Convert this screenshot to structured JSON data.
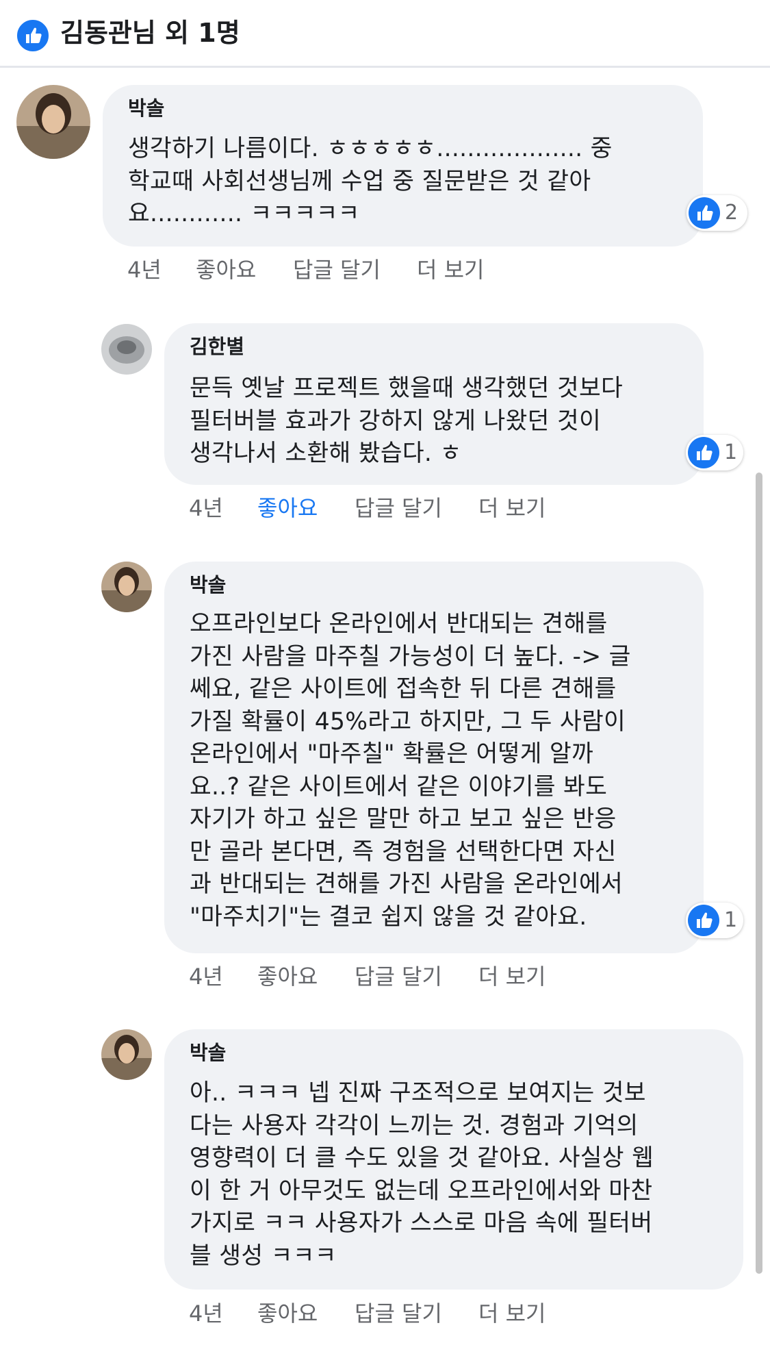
{
  "header": {
    "title": "김동관님 외 1명"
  },
  "comments": [
    {
      "author": "박솔",
      "lines": [
        "생각하기 나름이다. ㅎㅎㅎㅎㅎ................... 중",
        "학교때 사회선생님께 수업 중 질문받은 것 같아",
        "요............ ㅋㅋㅋㅋㅋ"
      ],
      "reactions": "2",
      "time": "4년",
      "like": "좋아요",
      "reply": "답글 달기",
      "more": "더 보기",
      "liked": false
    },
    {
      "author": "김한별",
      "lines": [
        "문득 옛날 프로젝트 했을때 생각했던 것보다",
        "필터버블 효과가 강하지 않게 나왔던 것이",
        "생각나서 소환해 봤습다. ㅎ"
      ],
      "reactions": "1",
      "time": "4년",
      "like": "좋아요",
      "reply": "답글 달기",
      "more": "더 보기",
      "liked": true
    },
    {
      "author": "박솔",
      "lines": [
        "오프라인보다 온라인에서 반대되는 견해를",
        "가진 사람을 마주칠 가능성이 더 높다. -> 글",
        "쎄요, 같은 사이트에 접속한 뒤 다른 견해를",
        "가질 확률이 45%라고 하지만, 그 두 사람이",
        "온라인에서 \"마주칠\" 확률은 어떻게 알까",
        "요..? 같은 사이트에서 같은 이야기를 봐도",
        "자기가 하고 싶은 말만 하고 보고 싶은 반응",
        "만 골라 본다면, 즉 경험을 선택한다면 자신",
        "과 반대되는 견해를 가진 사람을 온라인에서",
        "\"마주치기\"는 결코 쉽지 않을 것 같아요."
      ],
      "reactions": "1",
      "time": "4년",
      "like": "좋아요",
      "reply": "답글 달기",
      "more": "더 보기",
      "liked": false
    },
    {
      "author": "박솔",
      "lines": [
        "아.. ㅋㅋㅋ 넵 진짜 구조적으로 보여지는 것보",
        "다는 사용자 각각이 느끼는 것. 경험과 기억의",
        "영향력이 더 클 수도 있을 것 같아요. 사실상 웹",
        "이 한 거 아무것도 없는데 오프라인에서와 마찬",
        "가지로 ㅋㅋ 사용자가 스스로 마음 속에 필터버",
        "블 생성 ㅋㅋㅋ"
      ],
      "time": "4년",
      "like": "좋아요",
      "reply": "답글 달기",
      "more": "더 보기",
      "liked": false
    }
  ],
  "colors": {
    "accent": "#1877f2",
    "bubble": "#f0f2f5",
    "muted": "#65676b"
  },
  "icons": {
    "header": "thumbs-up-icon",
    "reaction": "thumbs-up-icon"
  }
}
